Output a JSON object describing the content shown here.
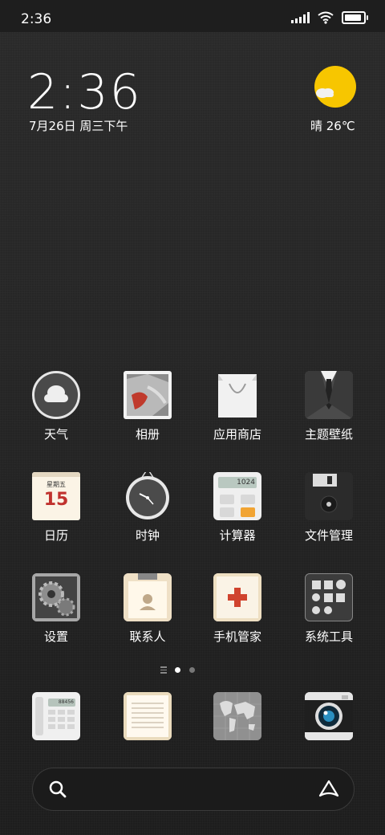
{
  "status_bar": {
    "time": "2:36"
  },
  "widget": {
    "time": "2:36",
    "date": "7月26日 周三下午",
    "weather": "晴 26℃"
  },
  "apps": [
    [
      {
        "label": "天气",
        "icon": "weather-icon"
      },
      {
        "label": "相册",
        "icon": "gallery-icon"
      },
      {
        "label": "应用商店",
        "icon": "app-store-icon"
      },
      {
        "label": "主题壁纸",
        "icon": "themes-icon"
      }
    ],
    [
      {
        "label": "日历",
        "icon": "calendar-icon",
        "calendar_weekday": "星期五",
        "calendar_day": "15"
      },
      {
        "label": "时钟",
        "icon": "clock-icon"
      },
      {
        "label": "计算器",
        "icon": "calculator-icon",
        "display": "1024"
      },
      {
        "label": "文件管理",
        "icon": "file-manager-icon"
      }
    ],
    [
      {
        "label": "设置",
        "icon": "settings-icon"
      },
      {
        "label": "联系人",
        "icon": "contacts-icon"
      },
      {
        "label": "手机管家",
        "icon": "security-icon"
      },
      {
        "label": "系统工具",
        "icon": "tools-icon"
      }
    ]
  ],
  "dock": [
    {
      "icon": "phone-icon",
      "display": "88456"
    },
    {
      "icon": "notes-icon"
    },
    {
      "icon": "browser-icon"
    },
    {
      "icon": "camera-icon"
    }
  ],
  "pager": {
    "pages": 2,
    "current": 1
  },
  "colors": {
    "background": "#262626",
    "weather_sun": "#f7c600",
    "calendar_red": "#c0322e"
  }
}
